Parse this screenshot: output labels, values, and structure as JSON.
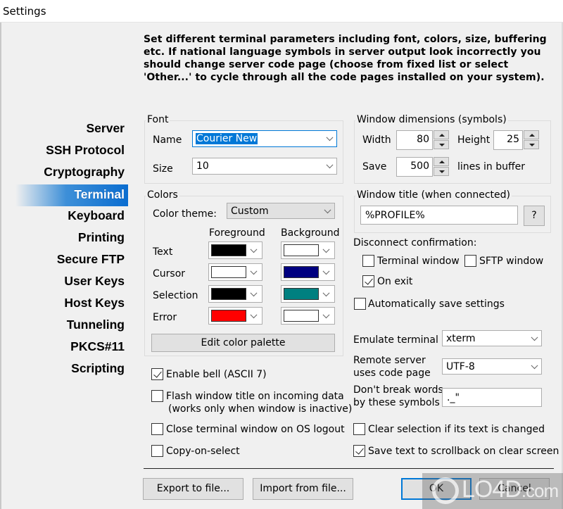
{
  "window": {
    "title": "Settings"
  },
  "intro": "Set different terminal parameters including font, colors, size, buffering etc. If national language symbols in server output look incorrectly you should change server code page (choose from fixed list or select 'Other...' to cycle through all the code pages installed on your system).",
  "sidebar": {
    "items": [
      {
        "label": "Server",
        "active": false
      },
      {
        "label": "SSH Protocol",
        "active": false
      },
      {
        "label": "Cryptography",
        "active": false
      },
      {
        "label": "Terminal",
        "active": true
      },
      {
        "label": "Keyboard",
        "active": false
      },
      {
        "label": "Printing",
        "active": false
      },
      {
        "label": "Secure FTP",
        "active": false
      },
      {
        "label": "User Keys",
        "active": false
      },
      {
        "label": "Host Keys",
        "active": false
      },
      {
        "label": "Tunneling",
        "active": false
      },
      {
        "label": "PKCS#11",
        "active": false
      },
      {
        "label": "Scripting",
        "active": false
      }
    ]
  },
  "font": {
    "group_label": "Font",
    "name_label": "Name",
    "name_value": "Courier New",
    "size_label": "Size",
    "size_value": "10"
  },
  "colors": {
    "group_label": "Colors",
    "theme_label": "Color theme:",
    "theme_value": "Custom",
    "fg_header": "Foreground",
    "bg_header": "Background",
    "rows": [
      {
        "label": "Text",
        "fg": "#000000",
        "bg": "#ffffff"
      },
      {
        "label": "Cursor",
        "fg": "#ffffff",
        "bg": "#000080"
      },
      {
        "label": "Selection",
        "fg": "#000000",
        "bg": "#008080"
      },
      {
        "label": "Error",
        "fg": "#ff0000",
        "bg": "#ffffff"
      }
    ],
    "edit_palette_label": "Edit color palette"
  },
  "window_dims": {
    "group_label": "Window dimensions (symbols)",
    "width_label": "Width",
    "width_value": "80",
    "height_label": "Height",
    "height_value": "25",
    "save_label": "Save",
    "save_value": "500",
    "buffer_label": "lines in buffer"
  },
  "window_title": {
    "group_label": "Window title (when connected)",
    "value": "%PROFILE%",
    "help_label": "?"
  },
  "disconnect": {
    "label": "Disconnect confirmation:",
    "terminal_window": {
      "label": "Terminal window",
      "checked": false
    },
    "sftp_window": {
      "label": "SFTP window",
      "checked": false
    },
    "on_exit": {
      "label": "On exit",
      "checked": true
    }
  },
  "auto_save": {
    "label": "Automatically save settings",
    "checked": false
  },
  "emulate": {
    "label": "Emulate terminal",
    "value": "xterm"
  },
  "code_page": {
    "label_line1": "Remote server",
    "label_line2": "uses code page",
    "value": "UTF-8"
  },
  "no_break": {
    "label_line1": "Don't break words",
    "label_line2": "by these symbols",
    "value": "._\""
  },
  "options_left": {
    "enable_bell": {
      "label": "Enable bell (ASCII 7)",
      "checked": true
    },
    "flash_title": {
      "label": "Flash window title on incoming data",
      "sublabel": "(works only when window is inactive)",
      "checked": false
    },
    "close_on_logout": {
      "label": "Close terminal window on OS logout",
      "checked": false
    },
    "copy_on_select": {
      "label": "Copy-on-select",
      "checked": false
    }
  },
  "options_right": {
    "clear_selection": {
      "label": "Clear selection if its text is changed",
      "checked": false
    },
    "save_scrollback": {
      "label": "Save text to scrollback on clear screen",
      "checked": true
    }
  },
  "footer": {
    "export_label": "Export to file...",
    "import_label": "Import from file...",
    "ok_label": "OK",
    "cancel_label": "Cancel"
  },
  "watermark": {
    "text": "LO4D",
    "suffix": ".com"
  }
}
